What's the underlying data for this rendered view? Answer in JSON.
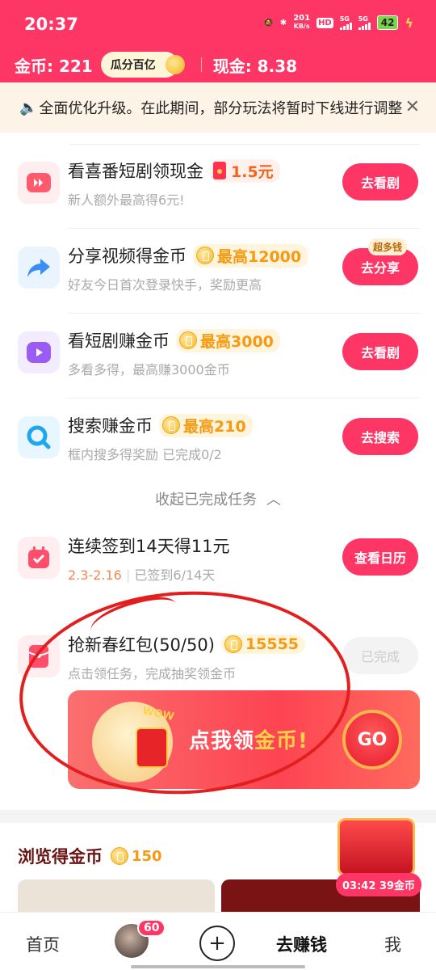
{
  "status_bar": {
    "time": "20:37",
    "net_speed_value": "201",
    "net_speed_unit": "KB/s",
    "hd_label": "HD",
    "sig1": "5G",
    "sig2": "5G",
    "battery": "42"
  },
  "header": {
    "coins_label": "金币: 221",
    "divide_button": "瓜分百亿",
    "cash_label": "现金: 8.38",
    "brand_color": "#fe3666"
  },
  "notice": {
    "text": "全面优化升级。在此期间，部分玩法将暂时下线进行调整",
    "close_icon": "close-icon"
  },
  "tasks": [
    {
      "title": "看喜番短剧领现金",
      "reward": "1.5元",
      "subtitle": "新人额外最高得6元!",
      "button": "去看剧",
      "icon": "play-icon"
    },
    {
      "title": "分享视频得金币",
      "reward": "最高12000",
      "subtitle": "好友今日首次登录快手，奖励更高",
      "button": "去分享",
      "tag": "超多钱",
      "icon": "share-icon"
    },
    {
      "title": "看短剧赚金币",
      "reward": "最高3000",
      "subtitle": "多看多得，最高赚3000金币",
      "button": "去看剧",
      "icon": "video-icon"
    },
    {
      "title": "搜索赚金币",
      "reward": "最高210",
      "subtitle": "框内搜多得奖励 已完成0/2",
      "button": "去搜索",
      "icon": "search-icon"
    }
  ],
  "collapse_label": "收起已完成任务",
  "checkin": {
    "title": "连续签到14天得11元",
    "date_range": "2.3-2.16",
    "progress": "已签到6/14天",
    "button": "查看日历"
  },
  "red_packet": {
    "title": "抢新春红包(50/50)",
    "reward": "15555",
    "subtitle": "点击领任务，完成抽奖领金币",
    "button": "已完成",
    "banner_text_a": "点我领",
    "banner_text_b": "金币!",
    "banner_go": "GO",
    "banner_wow": "WOW"
  },
  "browse": {
    "title": "浏览得金币",
    "amount": "150",
    "timer": "03:42 39金币"
  },
  "nav": {
    "home": "首页",
    "badge": "60",
    "plus": "+",
    "earn": "去赚钱",
    "me": "我"
  }
}
